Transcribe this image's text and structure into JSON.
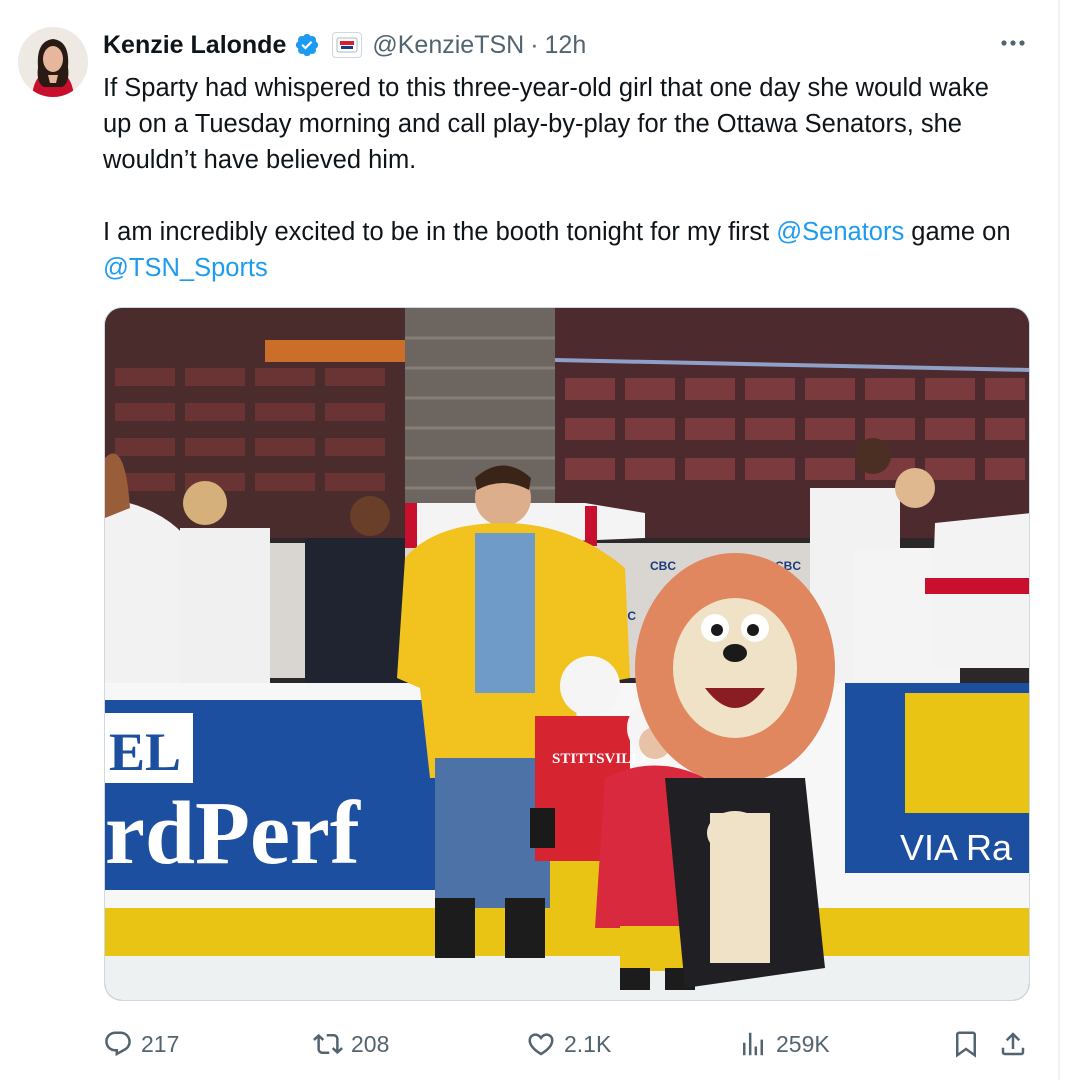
{
  "tweet": {
    "author_name": "Kenzie Lalonde",
    "handle": "@KenzieTSN",
    "separator": "·",
    "time": "12h",
    "text_line1": "If Sparty had whispered to this three-year-old girl that one day she would wake up on a Tuesday morning and call play-by-play for the Ottawa Senators, she wouldn’t have believed him.",
    "text2_before": "I am incredibly excited to be in the booth tonight for my first ",
    "mention1": "@Senators",
    "text2_middle": " game on ",
    "mention2": "@TSN_Sports",
    "icons": {
      "verified": "verified-badge-icon",
      "affiliation": "tsn-affiliate-badge-icon",
      "more": "more-dots-icon"
    },
    "photo": {
      "board_text_left": "rdPerf",
      "board_text_el": "EL",
      "board_text_right": "VIA Ra",
      "banner_text": "CBC SPORTS",
      "jersey_text": "STITTSVILLE",
      "colors": {
        "arena_seats": "#5a2a2a",
        "board_blue": "#1d4fa0",
        "board_yellow": "#e9c414",
        "jacket": "#f2c21f"
      }
    },
    "metrics": {
      "replies": "217",
      "retweets": "208",
      "likes": "2.1K",
      "views": "259K"
    },
    "accent_color": "#1d9bf0"
  }
}
